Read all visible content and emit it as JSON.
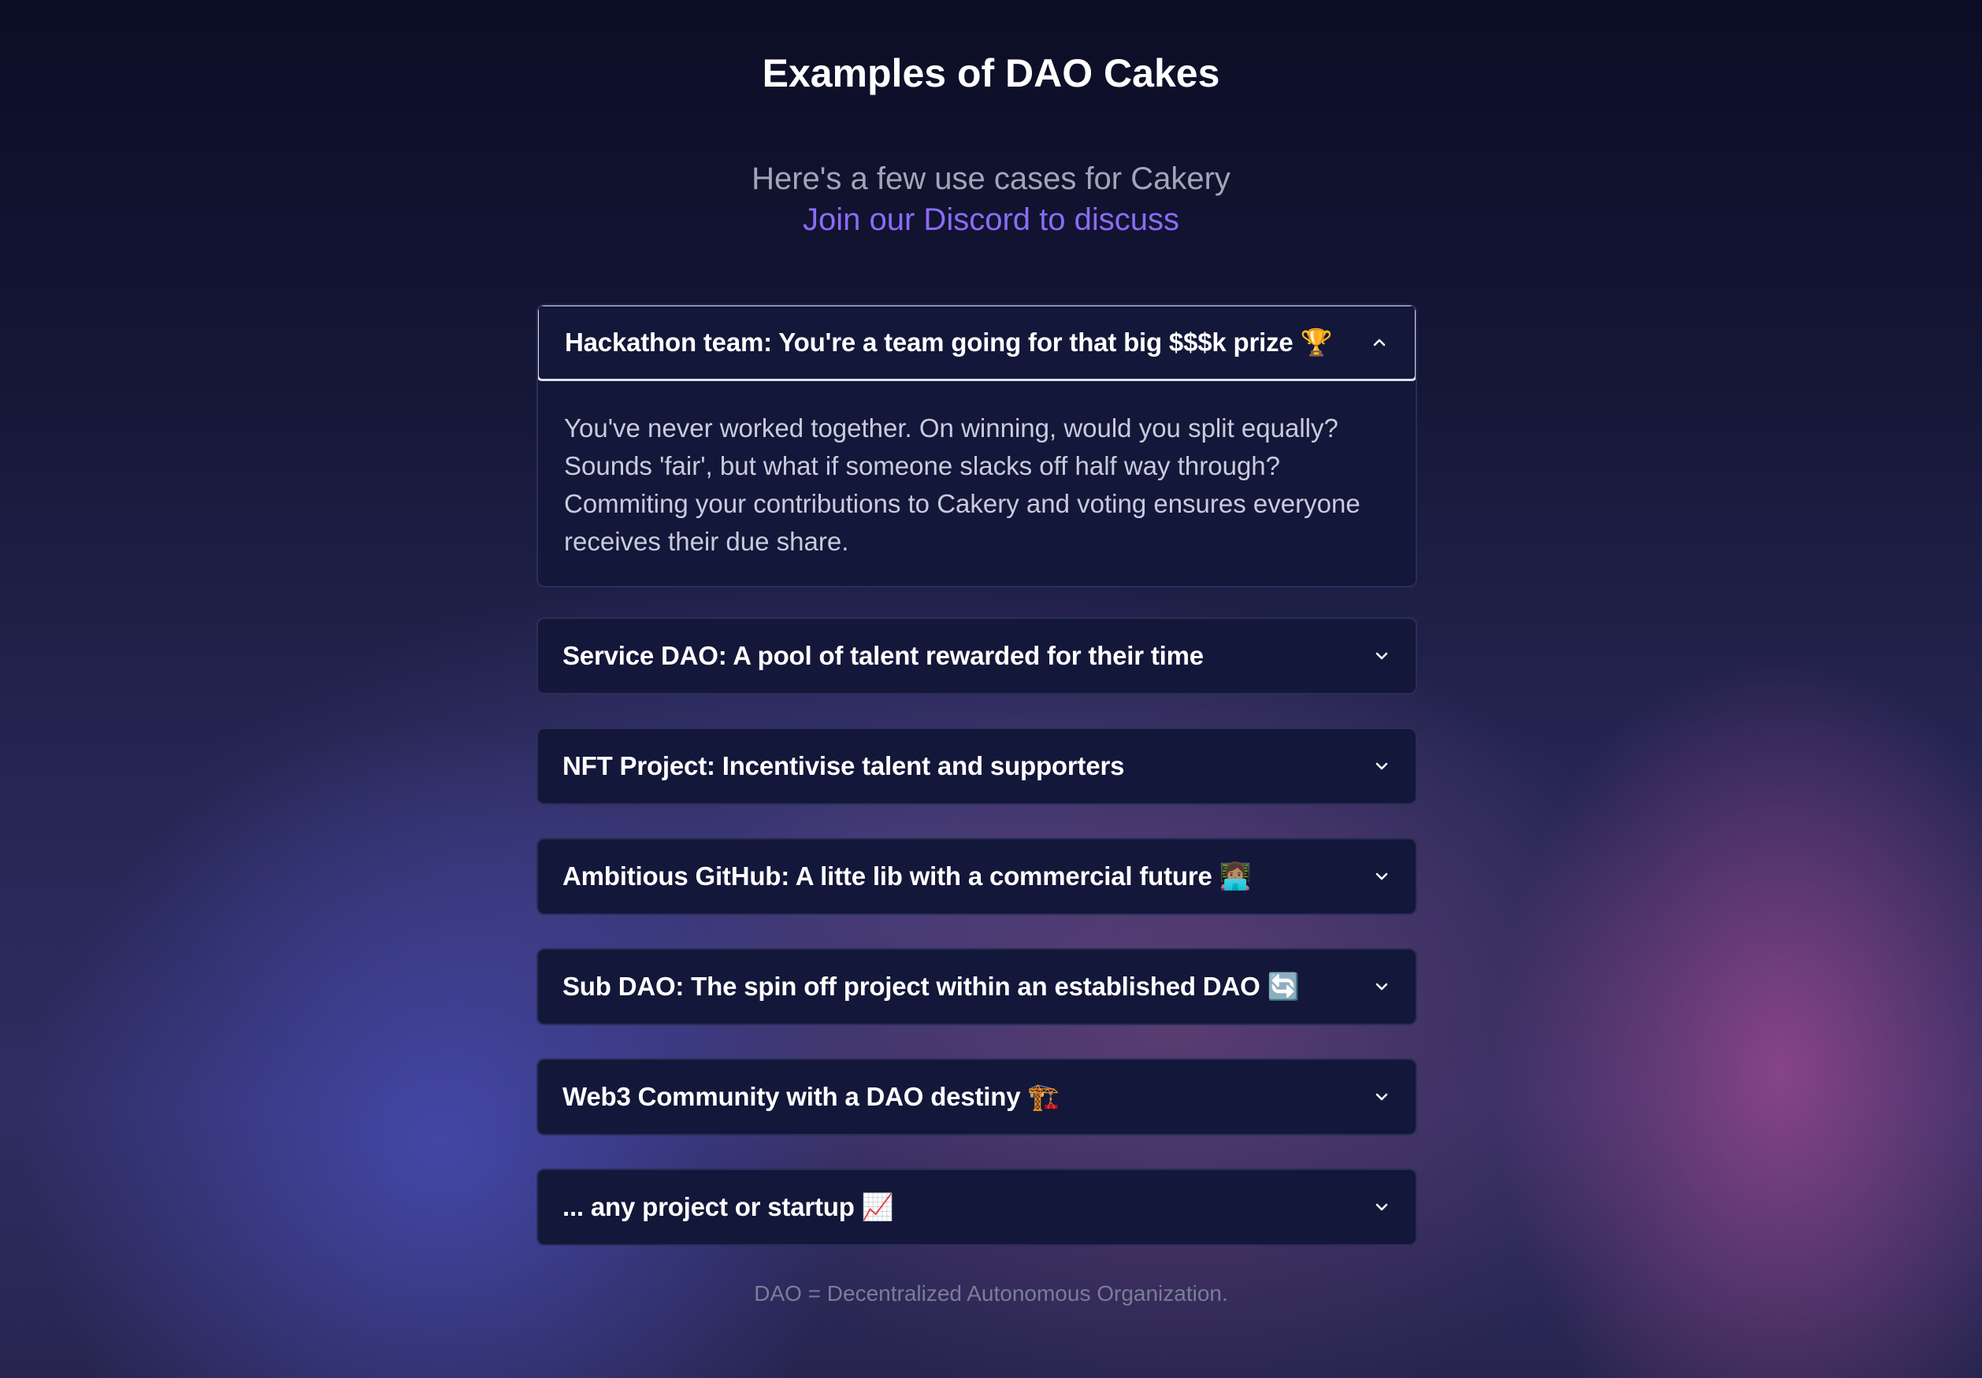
{
  "heading": "Examples of DAO Cakes",
  "intro": {
    "subtitle": "Here's a few use cases for Cakery",
    "discord_link": "Join our Discord to discuss"
  },
  "accordion": [
    {
      "title": "Hackathon team: You're a team going for that big $$$k prize 🏆",
      "expanded": true,
      "body": "You've never worked together. On winning, would you split equally? Sounds 'fair', but what if someone slacks off half way through? Commiting your contributions to Cakery and voting ensures everyone receives their due share."
    },
    {
      "title": "Service DAO: A pool of talent rewarded for their time",
      "expanded": false
    },
    {
      "title": "NFT Project: Incentivise talent and supporters",
      "expanded": false
    },
    {
      "title": "Ambitious GitHub: A litte lib with a commercial future 👩🏽‍💻",
      "expanded": false
    },
    {
      "title": "Sub DAO: The spin off project within an established DAO 🔄",
      "expanded": false
    },
    {
      "title": "Web3 Community with a DAO destiny 🏗️",
      "expanded": false
    },
    {
      "title": "... any project or startup 📈",
      "expanded": false
    }
  ],
  "footnote": "DAO = Decentralized Autonomous Organization.",
  "icons": {
    "expanded": "chevron-up-icon",
    "collapsed": "chevron-down-icon"
  },
  "colors": {
    "link": "#8a6cf5",
    "card": "#131739",
    "open_border": "#dcdfee"
  }
}
